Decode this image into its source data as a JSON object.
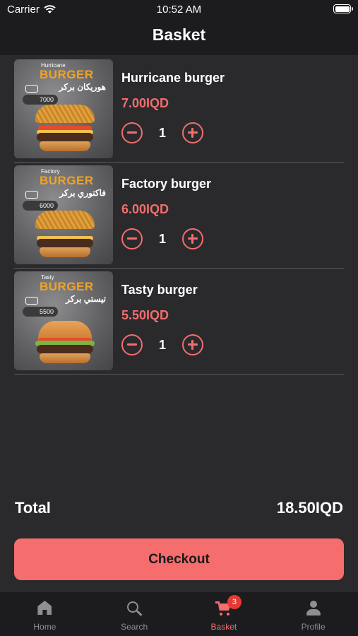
{
  "status_bar": {
    "carrier": "Carrier",
    "time": "10:52 AM",
    "wifi_icon": "wifi-icon",
    "battery_icon": "battery-icon"
  },
  "header": {
    "title": "Basket"
  },
  "items": [
    {
      "name": "Hurricane burger",
      "price": "7.00IQD",
      "quantity": "1",
      "image": {
        "small_name": "Hurricane",
        "brand": "BURGER",
        "arabic": "هوريكان بركر",
        "tag_price": "7000"
      }
    },
    {
      "name": "Factory burger",
      "price": "6.00IQD",
      "quantity": "1",
      "image": {
        "small_name": "Factory",
        "brand": "BURGER",
        "arabic": "فاكتوري بركر",
        "tag_price": "6000"
      }
    },
    {
      "name": "Tasty burger",
      "price": "5.50IQD",
      "quantity": "1",
      "image": {
        "small_name": "Tasty",
        "brand": "BURGER",
        "arabic": "تيستي بركر",
        "tag_price": "5500"
      }
    }
  ],
  "summary": {
    "total_label": "Total",
    "total_value": "18.50IQD"
  },
  "checkout": {
    "label": "Checkout"
  },
  "tabbar": {
    "tabs": [
      {
        "label": "Home",
        "icon": "home-icon"
      },
      {
        "label": "Search",
        "icon": "search-icon"
      },
      {
        "label": "Basket",
        "icon": "cart-icon",
        "badge": "3",
        "active": true
      },
      {
        "label": "Profile",
        "icon": "profile-icon"
      }
    ]
  },
  "colors": {
    "accent": "#f56d6d",
    "price": "#f26d6d",
    "background": "#2a2a2d",
    "header": "#1c1c1f",
    "badge": "#e53935",
    "inactive_tab": "#8e8e93"
  }
}
